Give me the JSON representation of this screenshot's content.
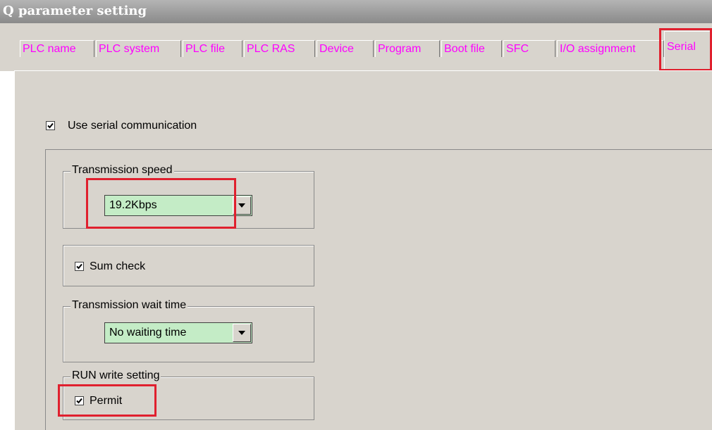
{
  "window": {
    "title": "Q parameter setting"
  },
  "tabs": [
    {
      "label": "PLC name"
    },
    {
      "label": "PLC system"
    },
    {
      "label": "PLC file"
    },
    {
      "label": "PLC RAS"
    },
    {
      "label": "Device"
    },
    {
      "label": "Program"
    },
    {
      "label": "Boot file"
    },
    {
      "label": "SFC"
    },
    {
      "label": "I/O assignment"
    },
    {
      "label": "Serial",
      "active": true
    }
  ],
  "serial": {
    "use_serial_label": "Use serial communication",
    "use_serial_checked": true,
    "transmission_speed": {
      "legend": "Transmission speed",
      "value": "19.2Kbps"
    },
    "sum_check": {
      "label": "Sum check",
      "checked": true
    },
    "wait_time": {
      "legend": "Transmission wait time",
      "value": "No waiting time"
    },
    "run_write": {
      "legend": "RUN write setting",
      "label": "Permit",
      "checked": true
    }
  },
  "colors": {
    "tab_text": "#ff00ff",
    "panel_bg": "#d8d4cd",
    "combo_bg": "#c4ecc6",
    "highlight": "#e0202e"
  }
}
